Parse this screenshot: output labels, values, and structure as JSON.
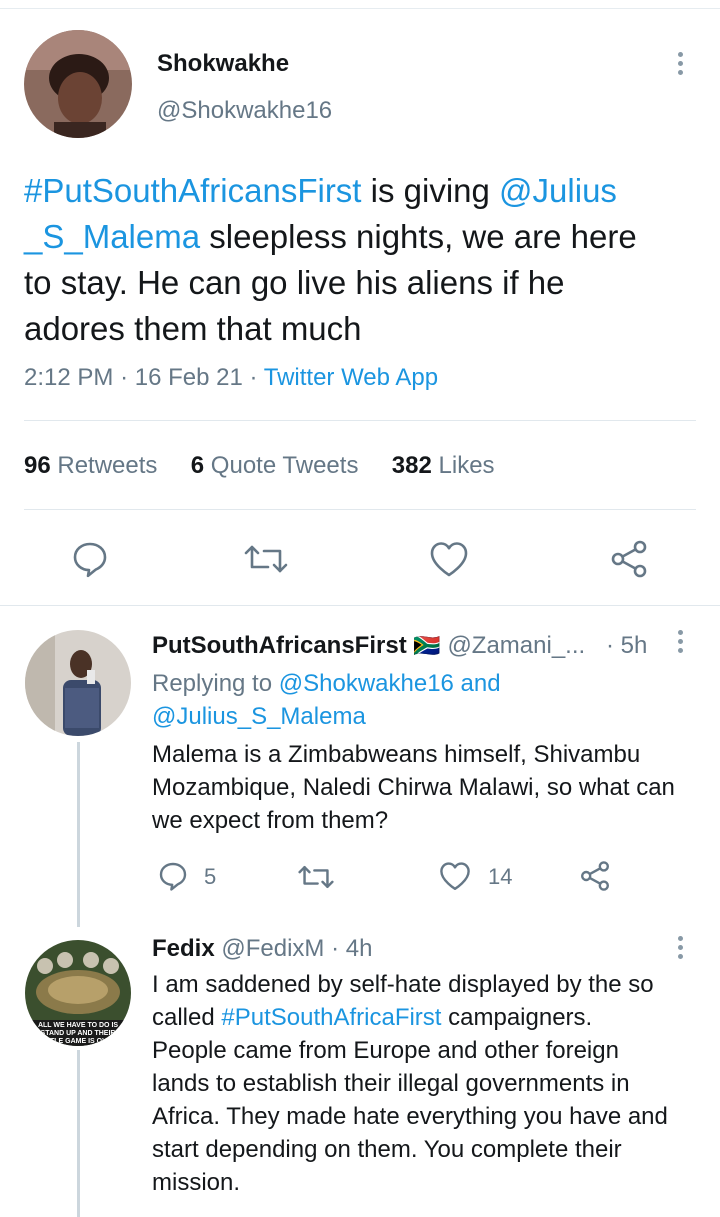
{
  "main_tweet": {
    "display_name": "Shokwakhe",
    "handle": "@Shokwakhe16",
    "text_lines": [
      {
        "hashtag": "#PutSouthAfricansFirst",
        "plain": " is giving ",
        "mention": "@Julius"
      },
      {
        "mention": "_S_Malema",
        "plain": " sleepless nights, we are here"
      },
      {
        "plain": "to stay. He can go live his aliens if he"
      },
      {
        "plain": "adores them that much"
      }
    ],
    "time": "2:12 PM",
    "separator": "·",
    "date": "16 Feb 21",
    "source": "Twitter Web App",
    "stats": {
      "retweets_count": "96",
      "retweets_label": "Retweets",
      "quotes_count": "6",
      "quotes_label": "Quote Tweets",
      "likes_count": "382",
      "likes_label": "Likes"
    }
  },
  "replies": [
    {
      "display_name": "PutSouthAfricansFirst",
      "flag": "🇿🇦",
      "handle": "@Zamani_...",
      "time": "· 5h",
      "replying_prefix": "Replying to ",
      "replying_user1": "@Shokwakhe16",
      "replying_and": " and",
      "replying_user2": "@Julius_S_Malema",
      "text_lines": [
        "Malema is a Zimbabweans himself, Shivambu",
        "Mozambique, Naledi Chirwa Malawi, so what can",
        "we expect from them?"
      ],
      "reply_count": "5",
      "like_count": "14"
    },
    {
      "display_name": "Fedix",
      "handle": "@FedixM",
      "time": "· 4h",
      "text_line1": "I am saddened by self-hate displayed by the so",
      "text_line2_plain": "called ",
      "text_line2_hashtag": "#PutSouthAfricaFirst",
      "text_line2_rest": " campaigners.",
      "text_lines_rest": [
        "People came from Europe and other foreign",
        "lands to establish their illegal governments in",
        "Africa. They made hate everything you have and",
        "start depending on them. You complete their",
        "mission."
      ],
      "avatar_caption": "ALL WE HAVE TO DO IS STAND UP AND THEIR LITTLE GAME IS OVER"
    }
  ]
}
